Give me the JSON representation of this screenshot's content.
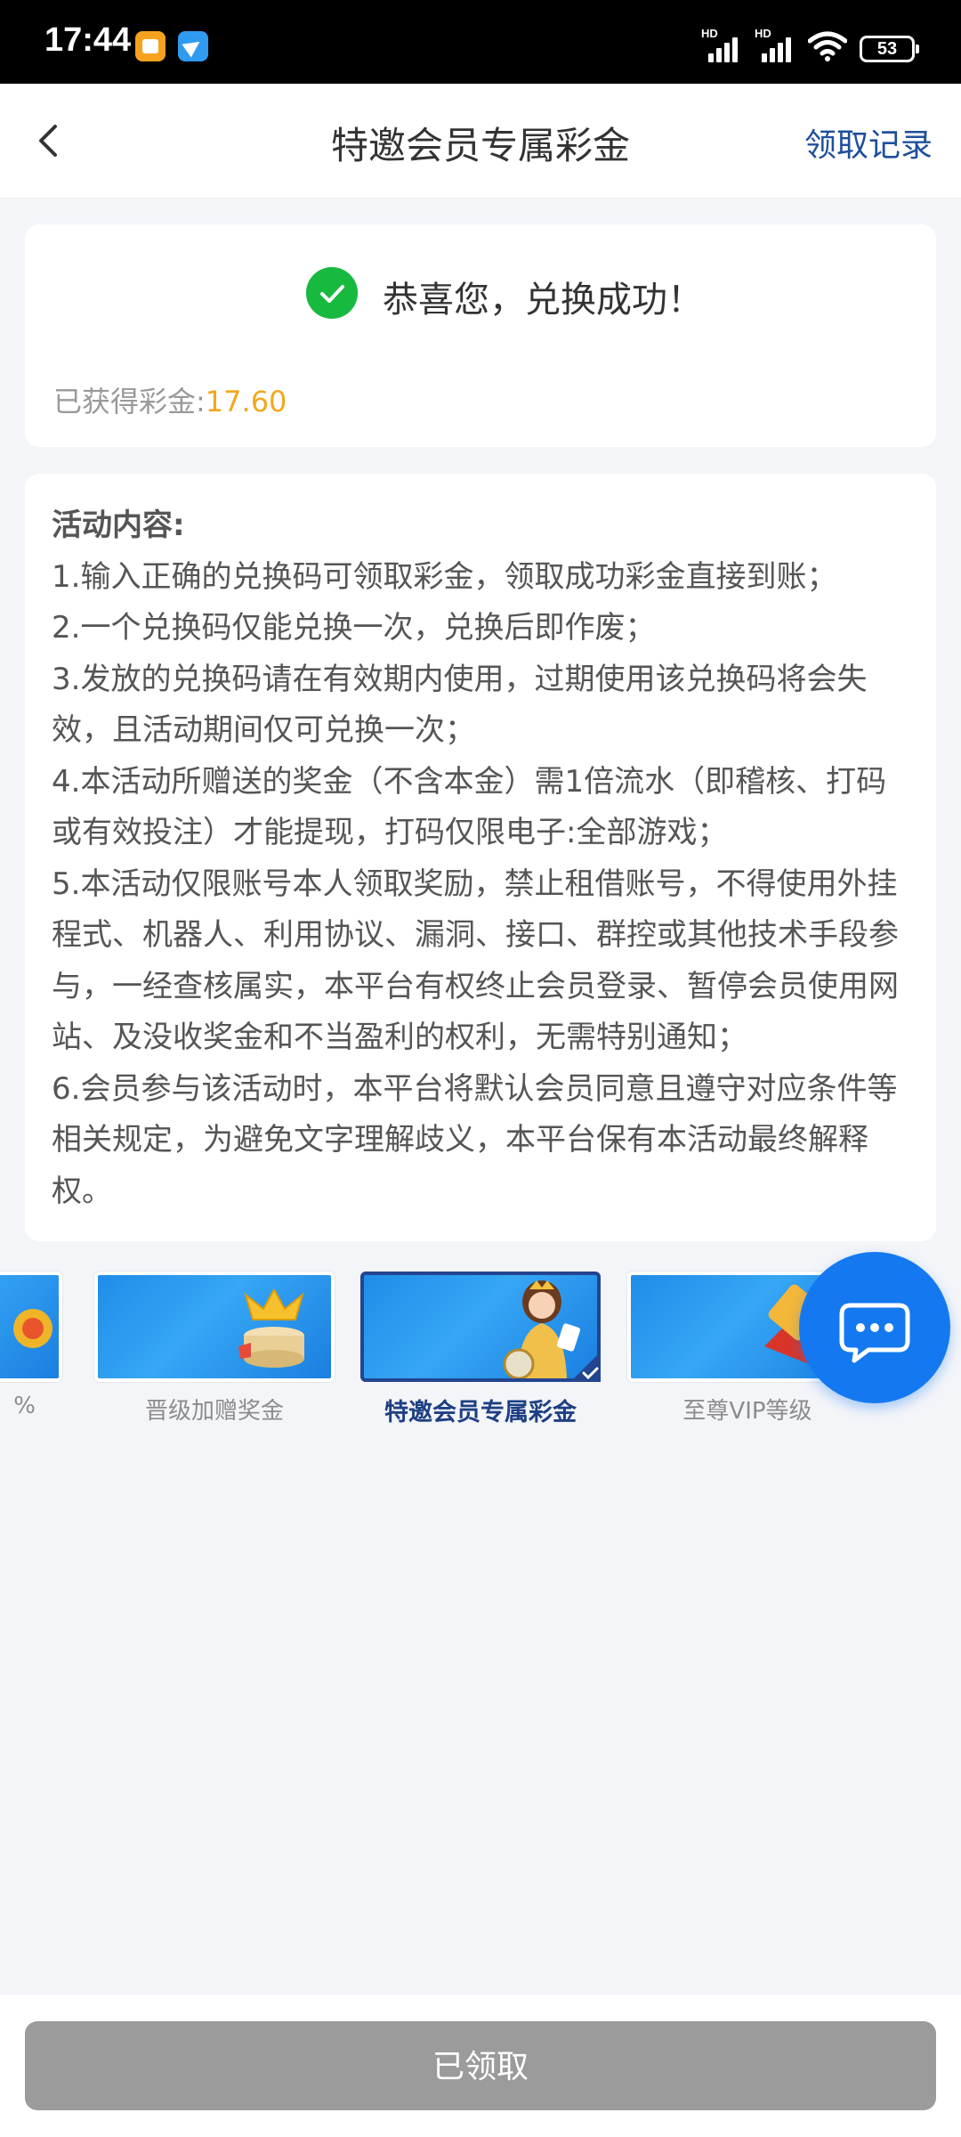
{
  "status_bar": {
    "time": "17:44",
    "battery": "53",
    "signal1_label": "HD",
    "signal2_label": "HD",
    "icons": [
      "notes-app-icon",
      "telegram-app-icon",
      "signal-icon",
      "signal-icon",
      "wifi-icon",
      "battery-icon"
    ]
  },
  "header": {
    "title": "特邀会员专属彩金",
    "records_link": "领取记录",
    "back_icon": "chevron-left-icon"
  },
  "success_card": {
    "message": "恭喜您，兑换成功！",
    "earned_label": "已获得彩金:",
    "earned_value": "17.60"
  },
  "rules": {
    "title": "活动内容:",
    "items": [
      "1.输入正确的兑换码可领取彩金，领取成功彩金直接到账；",
      "2.一个兑换码仅能兑换一次，兑换后即作废；",
      "3.发放的兑换码请在有效期内使用，过期使用该兑换码将会失效，且活动期间仅可兑换一次；",
      "4.本活动所赠送的奖金（不含本金）需1倍流水（即稽核、打码或有效投注）才能提现，打码仅限电子:全部游戏；",
      "5.本活动仅限账号本人领取奖励，禁止租借账号，不得使用外挂程式、机器人、利用协议、漏洞、接口、群控或其他技术手段参与，一经查核属实，本平台有权终止会员登录、暂停会员使用网站、及没收奖金和不当盈利的权利，无需特别通知；",
      "6.会员参与该活动时，本平台将默认会员同意且遵守对应条件等相关规定，为避免文字理解歧义，本平台保有本活动最终解释权。"
    ]
  },
  "carousel": {
    "items": [
      {
        "label": "%"
      },
      {
        "label": "晋级加赠奖金"
      },
      {
        "label": "特邀会员专属彩金",
        "active": true
      },
      {
        "label": "至尊VIP等级"
      }
    ]
  },
  "chat_button": {
    "icon": "chat-bubble-icon"
  },
  "footer": {
    "claim_button": "已领取"
  },
  "colors": {
    "accent_blue": "#1f4f9c",
    "success_green": "#18b93f",
    "amount_orange": "#f2a81c",
    "disabled_button": "#9b9b9b",
    "fab_blue": "#1479f0"
  }
}
